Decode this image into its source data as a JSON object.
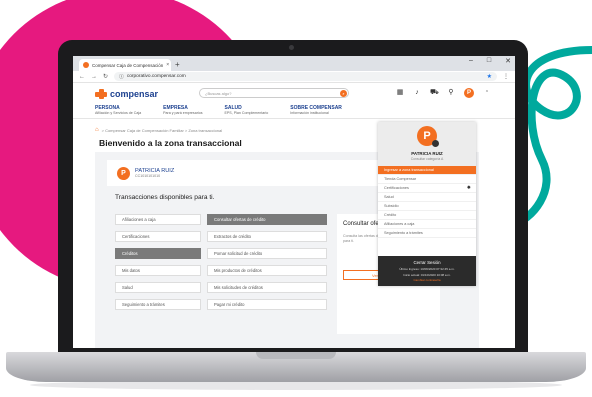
{
  "colors": {
    "brand_orange": "#f36f21",
    "brand_blue": "#1d4190",
    "pink": "#e6197f",
    "teal": "#00a99d"
  },
  "browser": {
    "tab_title": "Compensar Caja de Compensación",
    "url": "corporativo.compensar.com",
    "new_tab": "+",
    "window_controls": [
      "–",
      "□",
      "✕"
    ]
  },
  "header": {
    "logo_text": "compensar",
    "search_placeholder": "¿Buscas algo?",
    "icons": [
      "calendar-icon",
      "bell-icon",
      "cart-icon",
      "location-icon"
    ],
    "avatar_letter": "P"
  },
  "nav": [
    {
      "title": "PERSONA",
      "sub": "Afiliación y Servicios de Caja"
    },
    {
      "title": "EMPRESA",
      "sub": "Para y pará empresarios"
    },
    {
      "title": "SALUD",
      "sub": "EPS, Plan Complementario"
    },
    {
      "title": "SOBRE COMPENSAR",
      "sub": "Información institucional"
    }
  ],
  "breadcrumb": "> Compensar Caja de Compensación Familiar > Zona transaccional",
  "page_title": "Bienvenido a la zona transaccional",
  "user": {
    "letter": "P",
    "name": "PATRICIA RUIZ",
    "id": "CC1010101010"
  },
  "transactions_title": "Transacciones disponibles para ti.",
  "left_buttons": [
    "Afiliaciones a caja",
    "Certificaciones",
    "Créditos",
    "Mis datos",
    "Salud",
    "Seguimiento a trámites"
  ],
  "mid_buttons": [
    "Consultar ofertas de crédito",
    "Extractos de crédito",
    "Pomar solicitud de crédito",
    "Mis productos de créditos",
    "Mis solicitudes de créditos",
    "Pagar mi crédito"
  ],
  "side_panel": {
    "title": "Consultar ofe",
    "desc": "Consulta las ofertas de crédito que tiene para ti.",
    "button": "Ver ofertas",
    "button_icon": "arrow-right-icon"
  },
  "dropdown": {
    "letter": "P",
    "name": "PATRICIA RUIZ",
    "category": "Consultar categoría A",
    "items": [
      "Ingresar a zona transaccional",
      "Tienda Compensar",
      "Certificaciones",
      "Salud",
      "Subsidio",
      "Crédito",
      "Afiliaciones a caja",
      "Seguimiento a trámites"
    ],
    "logout": "Cerrar Sesión",
    "last_login": "Último Ingreso: 10/06/2020 07:32:45 a.m.",
    "session_start": "Inicio actual: 01/10/2020 10:08 a.m.",
    "change_password": "Cambiar contraseña"
  }
}
